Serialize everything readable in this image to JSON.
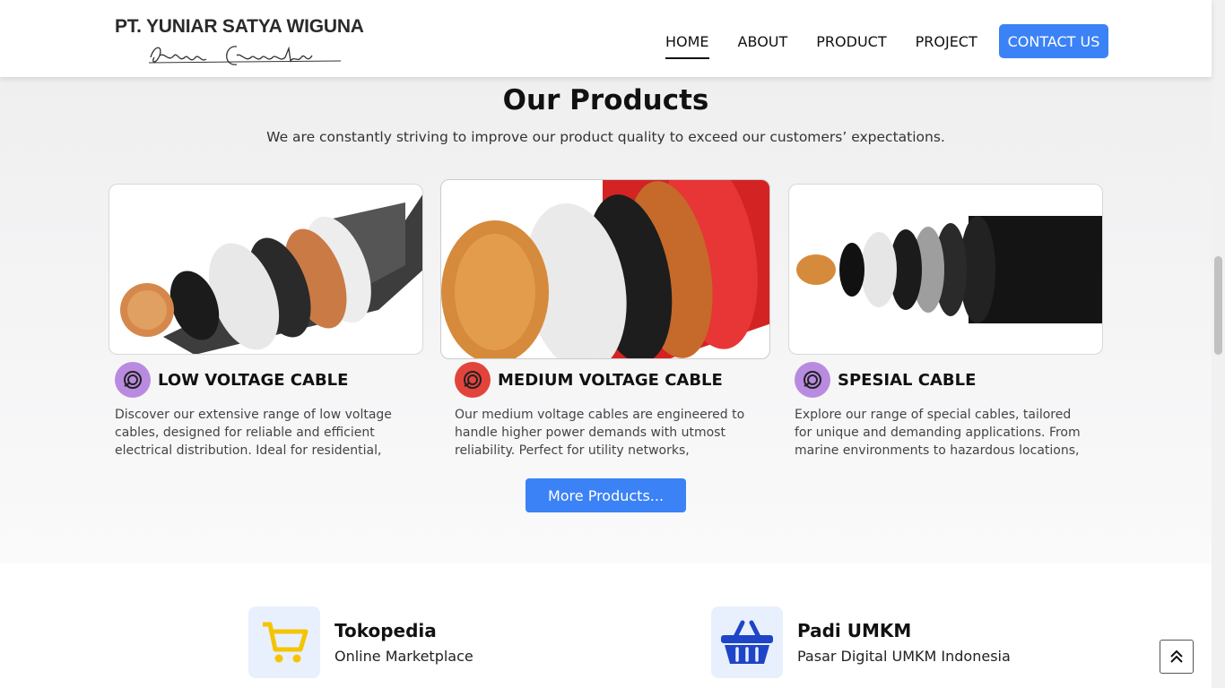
{
  "header": {
    "logo_title": "PT. YUNIAR SATYA WIGUNA",
    "logo_tagline": "Engineering Connected",
    "nav": [
      {
        "label": "HOME",
        "active": true
      },
      {
        "label": "ABOUT",
        "active": false
      },
      {
        "label": "PRODUCT",
        "active": false
      },
      {
        "label": "PROJECT",
        "active": false
      }
    ],
    "contact_label": "CONTACT US"
  },
  "products": {
    "title": "Our Products",
    "subtitle": "We are constantly striving to improve our product quality to exceed our customers’ expectations.",
    "items": [
      {
        "name": "LOW VOLTAGE CABLE",
        "icon": "cable-icon",
        "icon_bg": "#b98be0",
        "description": "Discover our extensive range of low voltage cables, designed for reliable and efficient electrical distribution. Ideal for residential, commercial, and…"
      },
      {
        "name": "MEDIUM VOLTAGE CABLE",
        "icon": "cable-icon",
        "icon_bg": "#e2443c",
        "description": "Our medium voltage cables are engineered to handle higher power demands with utmost reliability. Perfect for utility networks, industrial plants, and…"
      },
      {
        "name": "SPESIAL CABLE",
        "icon": "cable-icon",
        "icon_bg": "#b98be0",
        "description": "Explore our range of special cables, tailored for unique and demanding applications. From marine environments to hazardous locations, our cables…"
      }
    ],
    "more_label": "More Products..."
  },
  "marketplaces": [
    {
      "name": "Tokopedia",
      "desc": "Online Marketplace",
      "icon": "shopping-cart-icon",
      "color": "#f5c400"
    },
    {
      "name": "Padi UMKM",
      "desc": "Pasar Digital UMKM Indonesia",
      "icon": "basket-icon",
      "color": "#1e44c8"
    }
  ],
  "colors": {
    "accent": "#3b82f6"
  }
}
